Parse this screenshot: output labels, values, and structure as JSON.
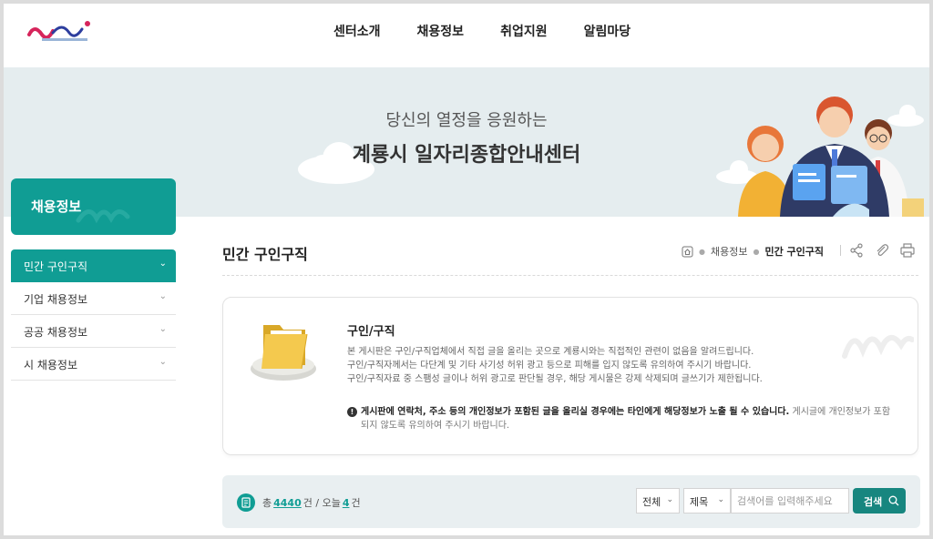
{
  "header": {
    "nav": [
      "센터소개",
      "채용정보",
      "취업지원",
      "알림마당"
    ]
  },
  "banner": {
    "subtitle": "당신의 열정을 응원하는",
    "title": "계룡시 일자리종합안내센터"
  },
  "sidebar": {
    "heading": "채용정보",
    "items": [
      {
        "label": "민간 구인구직",
        "active": true
      },
      {
        "label": "기업 채용정보",
        "active": false
      },
      {
        "label": "공공 채용정보",
        "active": false
      },
      {
        "label": "시 채용정보",
        "active": false
      }
    ]
  },
  "page": {
    "title": "민간 구인구직",
    "breadcrumb": [
      "채용정보",
      "민간 구인구직"
    ]
  },
  "notice": {
    "title": "구인/구직",
    "lines": [
      "본 게시판은 구인/구직업체에서 직접 글을 올리는 곳으로 계룡시와는 직접적인 관련이 없음을 알려드립니다.",
      "구인/구직자께서는 다단계 및 기타 사기성 허위 광고 등으로 피해를 입지 않도록 유의하여 주시기 바랍니다.",
      "구인/구직자료 중 스팸성 글이나 허위 광고로 판단될 경우, 해당 게시물은 강제 삭제되며 글쓰기가 제한됩니다."
    ],
    "warning_strong": "게시판에 연락처, 주소 등의 개인정보가 포함된 글을 올리실 경우에는 타인에게 해당정보가 노출 될 수 있습니다.",
    "warning_rest": " 게시글에 개인정보가 포함되지 않도록 유의하여 주시기 바랍니다."
  },
  "search": {
    "total_prefix": "총",
    "total": "4440",
    "total_unit": "건 / 오늘",
    "today": "4",
    "today_unit": "건",
    "category": "전체",
    "field": "제목",
    "placeholder": "검색어를 입력해주세요",
    "button": "검색"
  },
  "colors": {
    "accent": "#109d94",
    "banner_bg": "#e5edef",
    "search_bg": "#e9eff1"
  },
  "icons": [
    "home-icon",
    "share-icon",
    "paperclip-icon",
    "print-icon",
    "folder-icon",
    "alert-icon",
    "document-icon",
    "search-icon",
    "chevron-down-icon"
  ]
}
